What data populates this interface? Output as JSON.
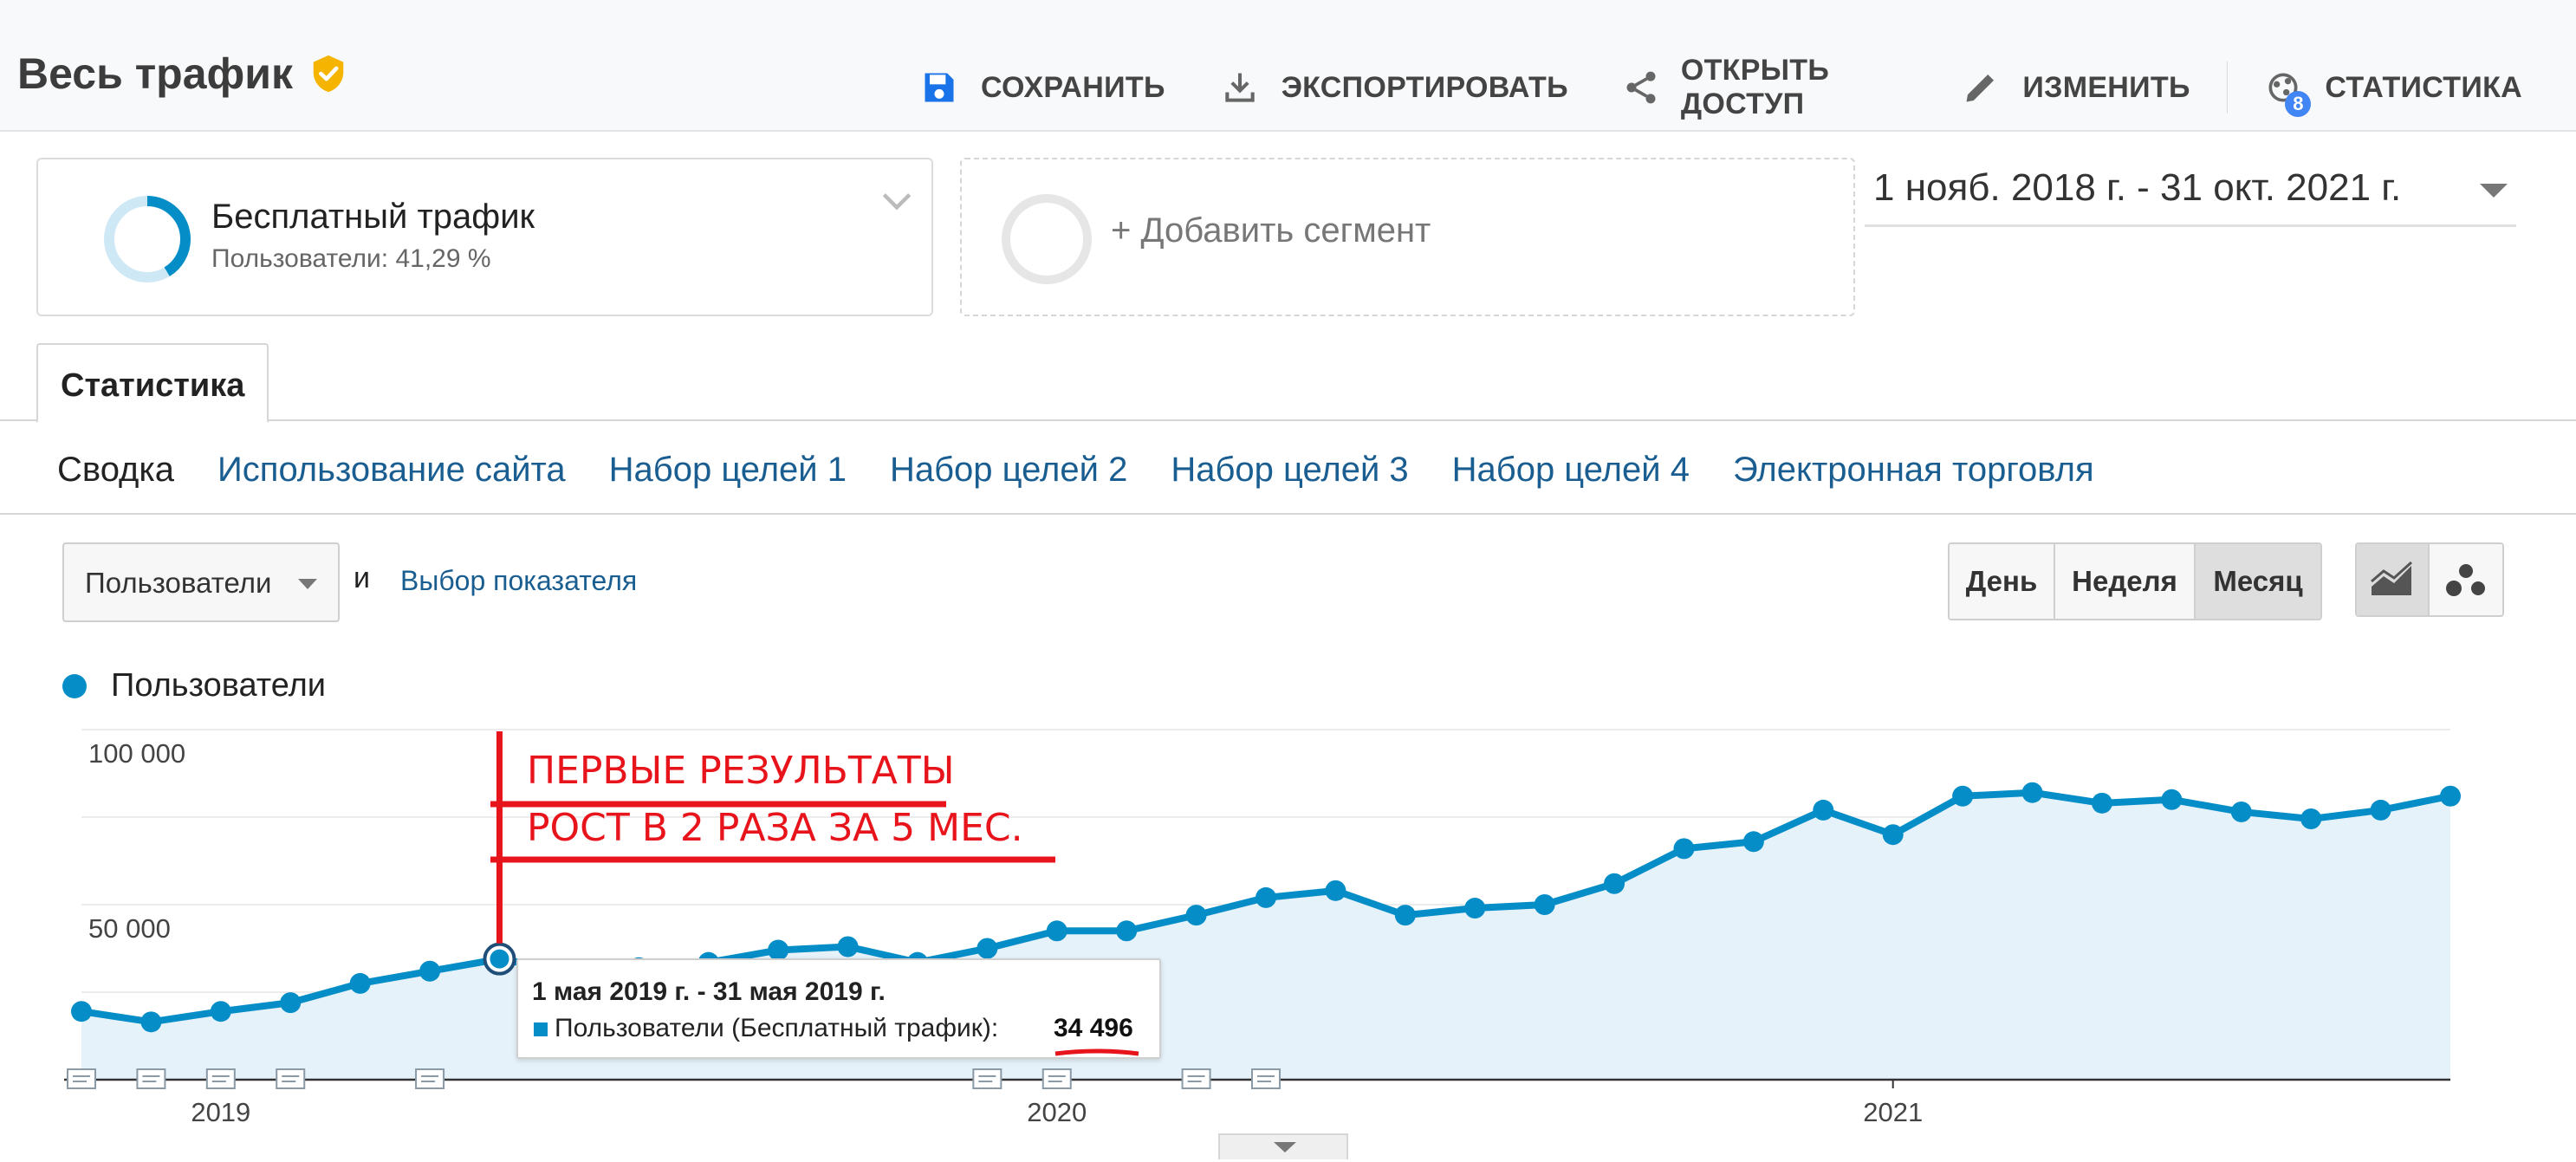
{
  "header": {
    "title": "Весь трафик",
    "actions": [
      {
        "label": "СОХРАНИТЬ",
        "icon": "save-icon"
      },
      {
        "label": "ЭКСПОРТИРОВАТЬ",
        "icon": "download-icon"
      },
      {
        "label": "ОТКРЫТЬ ДОСТУП",
        "icon": "share-icon"
      },
      {
        "label": "ИЗМЕНИТЬ",
        "icon": "pencil-icon"
      },
      {
        "label": "СТАТИСТИКА",
        "icon": "insights-icon",
        "badge": "8"
      }
    ]
  },
  "segment": {
    "name": "Бесплатный трафик",
    "sub": "Пользователи: 41,29 %",
    "share": 0.4129
  },
  "add_segment_label": "+ Добавить сегмент",
  "date_range": "1 нояб. 2018 г. - 31 окт. 2021 г.",
  "main_tab": "Статистика",
  "subtabs": [
    "Сводка",
    "Использование сайта",
    "Набор целей 1",
    "Набор целей 2",
    "Набор целей 3",
    "Набор целей 4",
    "Электронная торговля"
  ],
  "metric": {
    "selected": "Пользователи",
    "and": "и",
    "pick": "Выбор показателя"
  },
  "periods": [
    "День",
    "Неделя",
    "Месяц"
  ],
  "legend": "Пользователи",
  "tooltip": {
    "date": "1 мая 2019 г. - 31 мая 2019 г.",
    "series": "Пользователи (Бесплатный трафик):",
    "value": "34 496"
  },
  "annotation": {
    "line1": "ПЕРВЫЕ РЕЗУЛЬТАТЫ",
    "line2": "РОСТ В 2 РАЗА ЗА 5 МЕС."
  },
  "colors": {
    "series": "#058dc7",
    "area": "#e6f2fa",
    "annotation": "#e8141c"
  },
  "chart_data": {
    "type": "area",
    "ylim": [
      0,
      100000
    ],
    "yticks": [
      {
        "value": 100000,
        "label": "100 000"
      },
      {
        "value": 50000,
        "label": "50 000"
      }
    ],
    "xlabels": [
      {
        "index": 2,
        "label": "2019"
      },
      {
        "index": 14,
        "label": "2020"
      },
      {
        "index": 26,
        "label": "2021"
      }
    ],
    "highlight_index": 6,
    "note_markers": [
      0,
      1,
      2,
      3,
      5,
      13,
      14,
      16,
      17
    ],
    "series": [
      {
        "name": "Пользователи",
        "values": [
          19500,
          16500,
          19500,
          22000,
          27500,
          31000,
          34496,
          31000,
          32000,
          33500,
          37000,
          38000,
          33500,
          37500,
          42500,
          42500,
          47000,
          52000,
          54000,
          47000,
          49000,
          50000,
          56000,
          66000,
          68000,
          77000,
          70000,
          81000,
          82000,
          79000,
          80000,
          76500,
          74500,
          77000,
          81000
        ]
      }
    ]
  }
}
